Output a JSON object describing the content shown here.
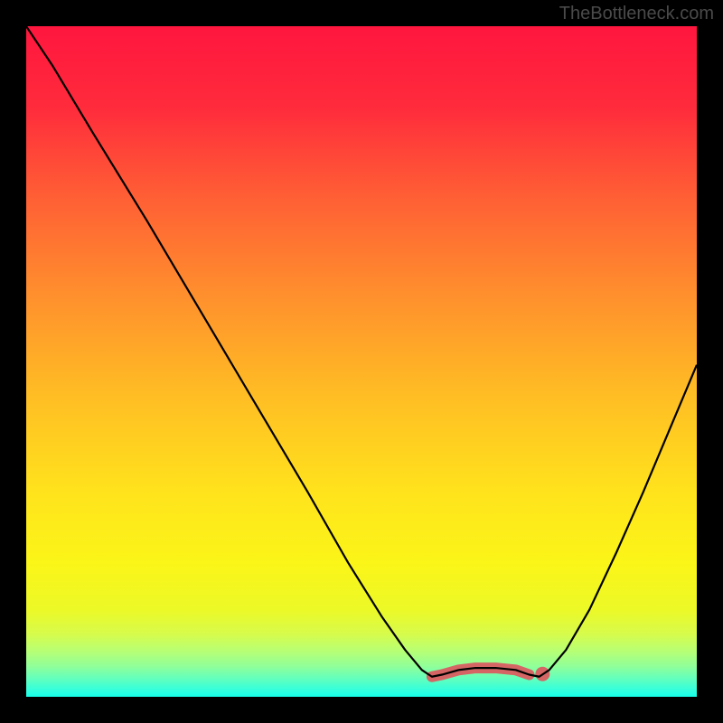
{
  "watermark": "TheBottleneck.com",
  "chart_data": {
    "type": "line",
    "title": "",
    "xlabel": "",
    "ylabel": "",
    "xlim": [
      0,
      100
    ],
    "ylim": [
      0,
      100
    ],
    "gradient_stops": [
      {
        "offset": 0.0,
        "color": "#ff163e"
      },
      {
        "offset": 0.12,
        "color": "#ff2b3c"
      },
      {
        "offset": 0.25,
        "color": "#ff5d35"
      },
      {
        "offset": 0.4,
        "color": "#ff8f2d"
      },
      {
        "offset": 0.55,
        "color": "#ffbd24"
      },
      {
        "offset": 0.7,
        "color": "#ffe41c"
      },
      {
        "offset": 0.8,
        "color": "#fbf518"
      },
      {
        "offset": 0.87,
        "color": "#ecf927"
      },
      {
        "offset": 0.905,
        "color": "#d8fb4a"
      },
      {
        "offset": 0.93,
        "color": "#baff71"
      },
      {
        "offset": 0.955,
        "color": "#8fff9a"
      },
      {
        "offset": 0.975,
        "color": "#5dffc1"
      },
      {
        "offset": 0.99,
        "color": "#33ffdd"
      },
      {
        "offset": 1.0,
        "color": "#16ffe8"
      }
    ],
    "series": [
      {
        "name": "curve",
        "points": [
          {
            "x": 0.0,
            "y": 100.0
          },
          {
            "x": 4.0,
            "y": 94.0
          },
          {
            "x": 10.0,
            "y": 84.0
          },
          {
            "x": 18.0,
            "y": 71.0
          },
          {
            "x": 26.0,
            "y": 57.5
          },
          {
            "x": 34.0,
            "y": 44.0
          },
          {
            "x": 42.0,
            "y": 30.5
          },
          {
            "x": 48.0,
            "y": 20.0
          },
          {
            "x": 53.0,
            "y": 12.0
          },
          {
            "x": 56.5,
            "y": 7.0
          },
          {
            "x": 59.0,
            "y": 4.0
          },
          {
            "x": 60.5,
            "y": 3.0
          },
          {
            "x": 62.0,
            "y": 3.3
          },
          {
            "x": 64.5,
            "y": 4.0
          },
          {
            "x": 67.0,
            "y": 4.3
          },
          {
            "x": 70.0,
            "y": 4.3
          },
          {
            "x": 73.0,
            "y": 4.0
          },
          {
            "x": 75.0,
            "y": 3.3
          },
          {
            "x": 76.5,
            "y": 3.0
          },
          {
            "x": 78.0,
            "y": 4.0
          },
          {
            "x": 80.5,
            "y": 7.0
          },
          {
            "x": 84.0,
            "y": 13.0
          },
          {
            "x": 88.0,
            "y": 21.5
          },
          {
            "x": 92.0,
            "y": 30.5
          },
          {
            "x": 96.0,
            "y": 40.0
          },
          {
            "x": 100.0,
            "y": 49.5
          }
        ]
      }
    ],
    "highlight_segments": [
      {
        "name": "highlight-flat",
        "color": "#d56565",
        "width": 12,
        "points": [
          {
            "x": 60.5,
            "y": 3.0
          },
          {
            "x": 62.0,
            "y": 3.3
          },
          {
            "x": 64.5,
            "y": 4.0
          },
          {
            "x": 67.0,
            "y": 4.3
          },
          {
            "x": 70.0,
            "y": 4.3
          },
          {
            "x": 73.0,
            "y": 4.0
          },
          {
            "x": 75.0,
            "y": 3.3
          }
        ]
      }
    ],
    "highlight_dots": [
      {
        "name": "highlight-dot",
        "color": "#d56565",
        "r": 8,
        "x": 77.0,
        "y": 3.4
      }
    ]
  }
}
